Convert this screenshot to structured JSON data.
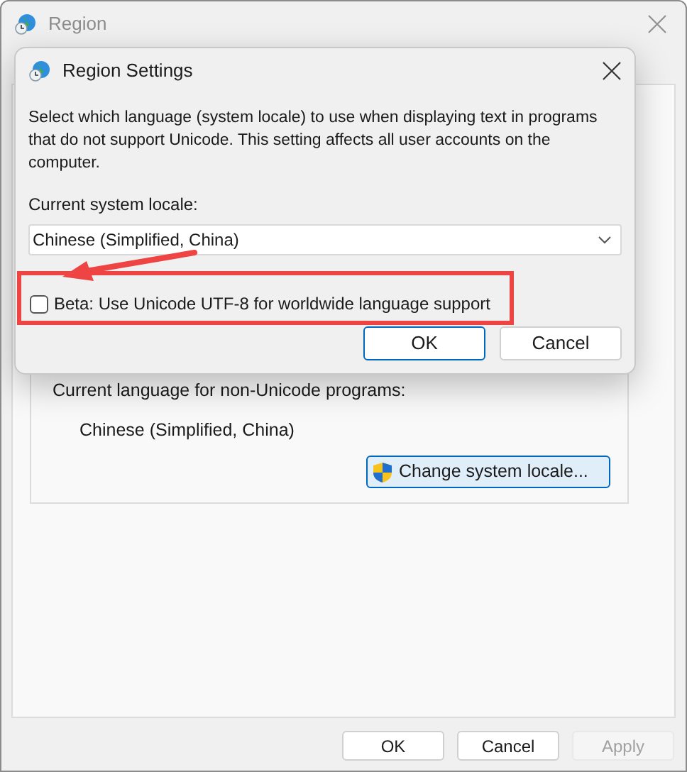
{
  "window": {
    "title": "Region"
  },
  "current_language": {
    "label": "Current language for non-Unicode programs:",
    "value": "Chinese (Simplified, China)"
  },
  "change_locale_button": "Change system locale...",
  "buttons": [
    {
      "label": "OK",
      "disabled": false
    },
    {
      "label": "Cancel",
      "disabled": false
    },
    {
      "label": "Apply",
      "disabled": true
    }
  ],
  "dialog": {
    "title": "Region Settings",
    "description": "Select which language (system locale) to use when displaying text in programs that do not support Unicode. This setting affects all user accounts on the computer.",
    "locale_label": "Current system locale:",
    "locale_value": "Chinese (Simplified, China)",
    "beta_option": {
      "label": "Beta: Use Unicode UTF-8 for worldwide language support",
      "checked": false
    },
    "buttons": [
      {
        "label": "OK",
        "default": true
      },
      {
        "label": "Cancel",
        "default": false
      }
    ]
  }
}
